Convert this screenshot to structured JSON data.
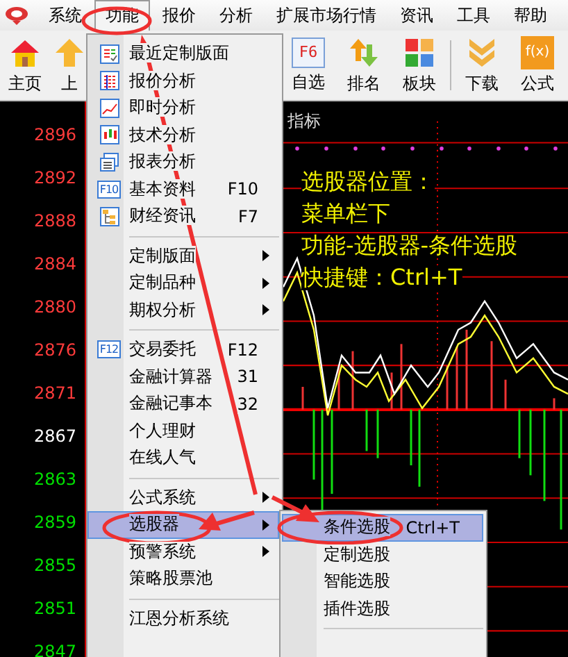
{
  "menubar": [
    {
      "label": "系统",
      "selected": false
    },
    {
      "label": "功能",
      "selected": true
    },
    {
      "label": "报价",
      "selected": false
    },
    {
      "label": "分析",
      "selected": false
    },
    {
      "label": "扩展市场行情",
      "selected": false
    },
    {
      "label": "资讯",
      "selected": false
    },
    {
      "label": "工具",
      "selected": false
    },
    {
      "label": "帮助",
      "selected": false
    }
  ],
  "toolbar_left": [
    {
      "label": "主页",
      "kind": "home"
    },
    {
      "label": "上",
      "kind": "up"
    }
  ],
  "toolbar_right": [
    {
      "label": "自选",
      "kind": "f6",
      "key": "F6"
    },
    {
      "label": "排名",
      "kind": "rank"
    },
    {
      "label": "板块",
      "kind": "blocks"
    },
    {
      "label": "下载",
      "kind": "download"
    },
    {
      "label": "公式",
      "kind": "formula",
      "key": "f(x)"
    }
  ],
  "price_axis": [
    {
      "text": "2896",
      "kind": "up"
    },
    {
      "text": "2892",
      "kind": "up"
    },
    {
      "text": "2888",
      "kind": "up"
    },
    {
      "text": "2884",
      "kind": "up"
    },
    {
      "text": "2880",
      "kind": "up"
    },
    {
      "text": "2876",
      "kind": "up"
    },
    {
      "text": "2871",
      "kind": "up"
    },
    {
      "text": "2867",
      "kind": "flat"
    },
    {
      "text": "2863",
      "kind": "down"
    },
    {
      "text": "2859",
      "kind": "down"
    },
    {
      "text": "2855",
      "kind": "down"
    },
    {
      "text": "2851",
      "kind": "down"
    },
    {
      "text": "2847",
      "kind": "down"
    }
  ],
  "indicator_title": "指标",
  "note": [
    "选股器位置：",
    "菜单栏下",
    "功能-选股器-条件选股",
    "快捷键：Ctrl+T"
  ],
  "menu": [
    {
      "kind": "item",
      "label": "最近定制版面",
      "selected": false
    },
    {
      "kind": "item",
      "label": "报价分析",
      "selected": false
    },
    {
      "kind": "item",
      "label": "即时分析",
      "selected": false
    },
    {
      "kind": "item",
      "label": "技术分析",
      "selected": false
    },
    {
      "kind": "item",
      "label": "报表分析",
      "selected": false
    },
    {
      "kind": "item",
      "label": "基本资料",
      "shortcut": "F10",
      "icon_text": "F10",
      "selected": false
    },
    {
      "kind": "item",
      "label": "财经资讯",
      "shortcut": "F7",
      "selected": false
    },
    {
      "kind": "separator"
    },
    {
      "kind": "submenu",
      "label": "定制版面",
      "selected": false
    },
    {
      "kind": "submenu",
      "label": "定制品种",
      "selected": false
    },
    {
      "kind": "submenu",
      "label": "期权分析",
      "selected": false
    },
    {
      "kind": "separator"
    },
    {
      "kind": "item",
      "label": "交易委托",
      "shortcut": "F12",
      "icon_text": "F12",
      "selected": false
    },
    {
      "kind": "item",
      "label": "金融计算器",
      "shortcut": "31",
      "selected": false
    },
    {
      "kind": "item",
      "label": "金融记事本",
      "shortcut": "32",
      "selected": false
    },
    {
      "kind": "item",
      "label": "个人理财",
      "selected": false
    },
    {
      "kind": "item",
      "label": "在线人气",
      "selected": false
    },
    {
      "kind": "separator"
    },
    {
      "kind": "submenu",
      "label": "公式系统",
      "selected": false
    },
    {
      "kind": "submenu",
      "label": "选股器",
      "selected": true
    },
    {
      "kind": "submenu",
      "label": "预警系统",
      "selected": false
    },
    {
      "kind": "item",
      "label": "策略股票池",
      "selected": false
    },
    {
      "kind": "separator"
    },
    {
      "kind": "item",
      "label": "江恩分析系统",
      "selected": false
    }
  ],
  "submenu": [
    {
      "kind": "item",
      "label": "条件选股",
      "shortcut": "Ctrl+T",
      "selected": true
    },
    {
      "kind": "item",
      "label": "定制选股",
      "selected": false
    },
    {
      "kind": "item",
      "label": "智能选股",
      "selected": false
    },
    {
      "kind": "item",
      "label": "插件选股",
      "selected": false
    },
    {
      "kind": "separator"
    }
  ]
}
